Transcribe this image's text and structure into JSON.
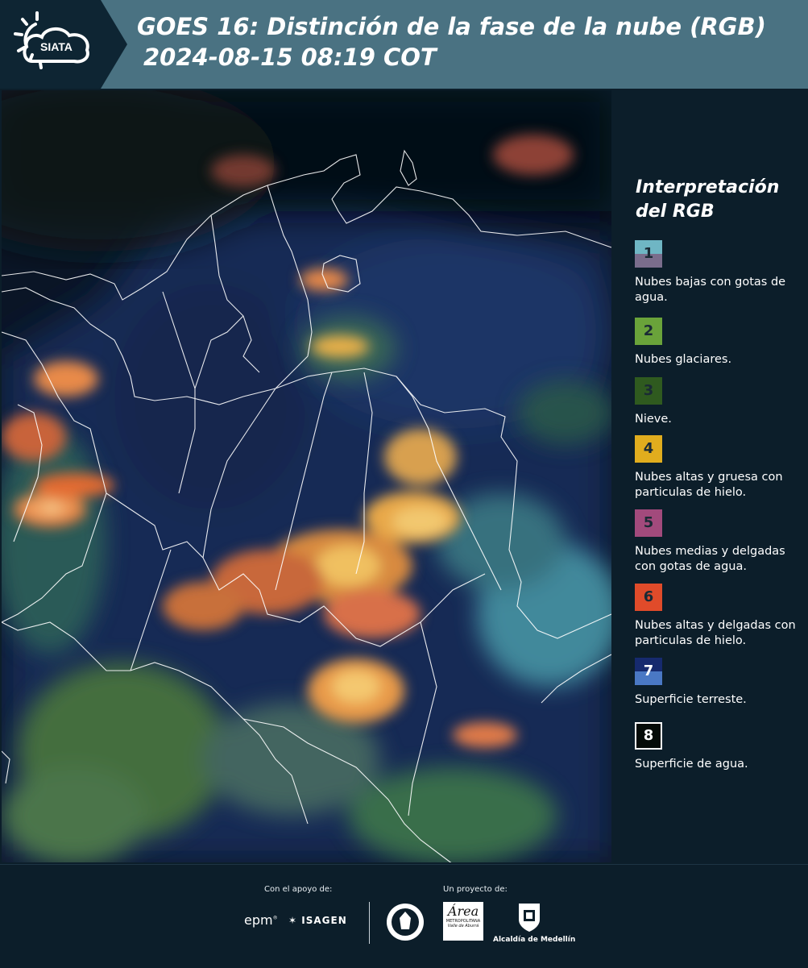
{
  "header": {
    "logo_text": "SIATA",
    "title_line1": "GOES 16: Distinción de la fase de la nube (RGB)",
    "title_line2": "2024-08-15 08:19 COT"
  },
  "legend": {
    "title": "Interpretación del RGB",
    "items": [
      {
        "num": "1",
        "label": "Nubes bajas con gotas de agua.",
        "color_top": "#6fb6c4",
        "color_bottom": "#7a6d8c"
      },
      {
        "num": "2",
        "label": "Nubes glaciares.",
        "color_top": "#6aa33a",
        "color_bottom": "#6aa33a"
      },
      {
        "num": "3",
        "label": "Nieve.",
        "color_top": "#2f5a1f",
        "color_bottom": "#2f5a1f"
      },
      {
        "num": "4",
        "label": "Nubes altas y gruesa con particulas de hielo.",
        "color_top": "#e1ad1e",
        "color_bottom": "#e1ad1e"
      },
      {
        "num": "5",
        "label": "Nubes medias y delgadas con gotas de agua.",
        "color_top": "#a24a7c",
        "color_bottom": "#a24a7c"
      },
      {
        "num": "6",
        "label": "Nubes altas y delgadas con particulas de hielo.",
        "color_top": "#e04b2a",
        "color_bottom": "#e04b2a"
      },
      {
        "num": "7",
        "label": "Superficie terreste.",
        "color_top": "#162a6e",
        "color_bottom": "#4a78c4"
      },
      {
        "num": "8",
        "label": "Superficie de agua.",
        "color_top": "#050b08",
        "color_bottom": "#050b08"
      }
    ]
  },
  "footer": {
    "support_label": "Con el apoyo de:",
    "project_label": "Un proyecto de:",
    "epm": "epm",
    "isagen": "ISAGEN",
    "area_metro": "METROPOLITANA",
    "area_sub": "Valle de Aburrá",
    "alcaldia": "Alcaldía de Medellín"
  }
}
